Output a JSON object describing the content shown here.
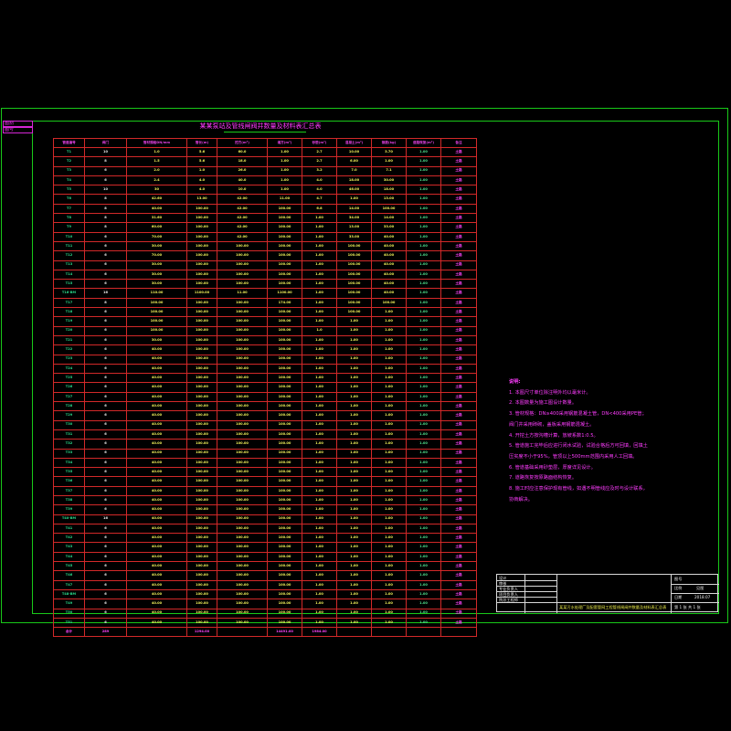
{
  "corner_tab": [
    "图别",
    "图号"
  ],
  "sheet_title": "某某泵站及管线闸阀井数量及材料表汇总表",
  "table": {
    "headers": [
      "管道编号",
      "阀门",
      "管材规格DN/mm",
      "管长(m)",
      "挖方(m³)",
      "填方(m³)",
      "砂垫(m³)",
      "混凝土(m³)",
      "钢筋(kg)",
      "道路恢复(m²)",
      "备注"
    ],
    "rows": [
      [
        "T1",
        "10",
        "1.0",
        "5.6",
        "60.0",
        "1.00",
        "2.7",
        "10.00",
        "3.70",
        "1.00",
        "土路"
      ],
      [
        "T2",
        "8",
        "1.5",
        "5.6",
        "18.0",
        "1.00",
        "2.7",
        "6.00",
        "1.00",
        "1.00",
        "土路"
      ],
      [
        "T3",
        "6",
        "2.0",
        "1.0",
        "26.0",
        "1.00",
        "3.2",
        "7.0",
        "7.1",
        "1.00",
        "土路"
      ],
      [
        "T4",
        "6",
        "2.4",
        "4.0",
        "40.0",
        "1.00",
        "4.0",
        "18.00",
        "30.00",
        "1.00",
        "土路"
      ],
      [
        "T5",
        "10",
        "30",
        "4.0",
        "10.0",
        "1.00",
        "4.0",
        "46.00",
        "18.00",
        "1.00",
        "土路"
      ],
      [
        "T6",
        "8",
        "42.60",
        "13.00",
        "42.00",
        "11.00",
        "4.7",
        "1.00",
        "13.00",
        "1.00",
        "土路"
      ],
      [
        "T7",
        "8",
        "40.00",
        "100.00",
        "42.00",
        "100.00",
        "6.8",
        "14.00",
        "100.00",
        "1.00",
        "土路"
      ],
      [
        "T8",
        "8",
        "31.60",
        "100.00",
        "42.00",
        "100.00",
        "1.00",
        "34.00",
        "14.00",
        "1.00",
        "土路"
      ],
      [
        "T9",
        "8",
        "60.00",
        "100.00",
        "42.00",
        "100.00",
        "1.00",
        "13.00",
        "33.00",
        "1.00",
        "土路"
      ],
      [
        "T10",
        "6",
        "70.00",
        "100.00",
        "42.00",
        "100.00",
        "1.00",
        "33.00",
        "40.00",
        "1.00",
        "土路"
      ],
      [
        "T11",
        "6",
        "30.00",
        "100.00",
        "100.00",
        "100.00",
        "1.00",
        "100.00",
        "40.00",
        "1.00",
        "土路"
      ],
      [
        "T12",
        "6",
        "70.00",
        "100.00",
        "100.00",
        "100.00",
        "1.00",
        "100.00",
        "40.00",
        "1.00",
        "土路"
      ],
      [
        "T13",
        "6",
        "30.00",
        "100.00",
        "100.00",
        "100.00",
        "1.00",
        "100.00",
        "40.00",
        "1.00",
        "土路"
      ],
      [
        "T14",
        "6",
        "30.00",
        "100.00",
        "100.00",
        "100.00",
        "1.00",
        "100.00",
        "40.00",
        "1.00",
        "土路"
      ],
      [
        "T15",
        "6",
        "30.00",
        "100.00",
        "100.00",
        "100.00",
        "1.00",
        "100.00",
        "40.00",
        "1.00",
        "土路"
      ],
      [
        "T16-BM",
        "16",
        "110.00",
        "1100.00",
        "11.00",
        "1100.00",
        "1.00",
        "100.00",
        "40.00",
        "1.00",
        "土路"
      ],
      [
        "T17",
        "8",
        "100.00",
        "100.00",
        "100.00",
        "174.00",
        "1.00",
        "100.00",
        "100.00",
        "1.00",
        "土路"
      ],
      [
        "T18",
        "6",
        "100.00",
        "100.00",
        "100.00",
        "100.00",
        "1.00",
        "100.00",
        "1.00",
        "1.00",
        "土路"
      ],
      [
        "T19",
        "6",
        "100.00",
        "100.00",
        "100.00",
        "100.00",
        "1.00",
        "1.00",
        "1.00",
        "1.00",
        "土路"
      ],
      [
        "T20",
        "6",
        "100.00",
        "100.00",
        "100.00",
        "100.00",
        "1.0",
        "1.00",
        "1.00",
        "1.00",
        "土路"
      ],
      [
        "T21",
        "6",
        "30.00",
        "100.00",
        "100.00",
        "100.00",
        "1.00",
        "1.00",
        "1.00",
        "1.00",
        "土路"
      ],
      [
        "T22",
        "6",
        "40.00",
        "100.00",
        "100.00",
        "100.00",
        "1.00",
        "1.00",
        "1.00",
        "1.00",
        "土路"
      ],
      [
        "T23",
        "6",
        "40.00",
        "100.00",
        "100.00",
        "100.00",
        "1.00",
        "1.00",
        "1.00",
        "1.00",
        "土路"
      ],
      [
        "T24",
        "6",
        "40.00",
        "100.00",
        "100.00",
        "100.00",
        "1.00",
        "1.00",
        "1.00",
        "1.00",
        "土路"
      ],
      [
        "T25",
        "6",
        "40.00",
        "100.00",
        "100.00",
        "100.00",
        "1.00",
        "1.00",
        "1.00",
        "1.00",
        "土路"
      ],
      [
        "T26",
        "6",
        "40.00",
        "100.00",
        "100.00",
        "100.00",
        "1.00",
        "1.00",
        "1.00",
        "1.00",
        "土路"
      ],
      [
        "T27",
        "6",
        "40.00",
        "100.00",
        "100.00",
        "100.00",
        "1.00",
        "1.00",
        "1.00",
        "1.00",
        "土路"
      ],
      [
        "T28",
        "6",
        "40.00",
        "100.00",
        "100.00",
        "100.00",
        "1.00",
        "1.00",
        "1.00",
        "1.00",
        "土路"
      ],
      [
        "T29",
        "6",
        "40.00",
        "100.00",
        "100.00",
        "100.00",
        "1.00",
        "1.00",
        "1.00",
        "1.00",
        "土路"
      ],
      [
        "T30",
        "6",
        "40.00",
        "100.00",
        "100.00",
        "100.00",
        "1.00",
        "1.00",
        "1.00",
        "1.00",
        "土路"
      ],
      [
        "T31",
        "6",
        "40.00",
        "100.00",
        "100.00",
        "100.00",
        "1.00",
        "1.00",
        "1.00",
        "1.00",
        "土路"
      ],
      [
        "T32",
        "6",
        "40.00",
        "100.00",
        "100.00",
        "100.00",
        "1.00",
        "1.00",
        "1.00",
        "1.00",
        "土路"
      ],
      [
        "T33",
        "6",
        "40.00",
        "100.00",
        "100.00",
        "100.00",
        "1.00",
        "1.00",
        "1.00",
        "1.00",
        "土路"
      ],
      [
        "T34",
        "6",
        "40.00",
        "100.00",
        "100.00",
        "100.00",
        "1.00",
        "1.00",
        "1.00",
        "1.00",
        "土路"
      ],
      [
        "T35",
        "6",
        "40.00",
        "100.00",
        "100.00",
        "100.00",
        "1.00",
        "1.00",
        "1.00",
        "1.00",
        "土路"
      ],
      [
        "T36",
        "6",
        "40.00",
        "100.00",
        "100.00",
        "100.00",
        "1.00",
        "1.00",
        "1.00",
        "1.00",
        "土路"
      ],
      [
        "T37",
        "6",
        "40.00",
        "100.00",
        "100.00",
        "100.00",
        "1.00",
        "1.00",
        "1.00",
        "1.00",
        "土路"
      ],
      [
        "T38",
        "6",
        "40.00",
        "100.00",
        "100.00",
        "100.00",
        "1.00",
        "1.00",
        "1.00",
        "1.00",
        "土路"
      ],
      [
        "T39",
        "6",
        "40.00",
        "100.00",
        "100.00",
        "100.00",
        "1.00",
        "1.00",
        "1.00",
        "1.00",
        "土路"
      ],
      [
        "T40-BM",
        "16",
        "40.00",
        "100.00",
        "100.00",
        "100.00",
        "1.00",
        "1.00",
        "1.00",
        "1.00",
        "土路"
      ],
      [
        "T41",
        "6",
        "40.00",
        "100.00",
        "100.00",
        "100.00",
        "1.00",
        "1.00",
        "1.00",
        "1.00",
        "土路"
      ],
      [
        "T42",
        "6",
        "40.00",
        "100.00",
        "100.00",
        "100.00",
        "1.00",
        "1.00",
        "1.00",
        "1.00",
        "土路"
      ],
      [
        "T43",
        "6",
        "40.00",
        "100.00",
        "100.00",
        "100.00",
        "1.00",
        "1.00",
        "1.00",
        "1.00",
        "土路"
      ],
      [
        "T44",
        "6",
        "40.00",
        "100.00",
        "100.00",
        "100.00",
        "1.00",
        "1.00",
        "1.00",
        "1.00",
        "土路"
      ],
      [
        "T45",
        "6",
        "40.00",
        "100.00",
        "100.00",
        "100.00",
        "1.00",
        "1.00",
        "1.00",
        "1.00",
        "土路"
      ],
      [
        "T46",
        "6",
        "40.00",
        "100.00",
        "100.00",
        "100.00",
        "1.00",
        "1.00",
        "1.00",
        "1.00",
        "土路"
      ],
      [
        "T47",
        "6",
        "40.00",
        "100.00",
        "100.00",
        "100.00",
        "1.00",
        "1.00",
        "1.00",
        "1.00",
        "土路"
      ],
      [
        "T48-BM",
        "6",
        "40.00",
        "100.00",
        "100.00",
        "100.00",
        "1.00",
        "1.00",
        "1.00",
        "1.00",
        "土路"
      ],
      [
        "T49",
        "6",
        "40.00",
        "100.00",
        "100.00",
        "100.00",
        "1.00",
        "1.00",
        "1.00",
        "1.00",
        "土路"
      ],
      [
        "T50",
        "6",
        "40.00",
        "100.00",
        "100.00",
        "100.00",
        "1.00",
        "1.00",
        "1.00",
        "1.00",
        "土路"
      ],
      [
        "T51",
        "6",
        "40.00",
        "100.00",
        "100.00",
        "100.00",
        "1.00",
        "1.00",
        "1.00",
        "1.00",
        "土路"
      ]
    ],
    "total": [
      "合计",
      "289",
      "",
      "1294.00",
      "",
      "14491.00",
      "1984.00",
      "",
      "",
      "",
      ""
    ]
  },
  "notes": {
    "title": "说明:",
    "lines": [
      "1. 本图尺寸单位除注明外均以毫米计。",
      "2. 本图数量为施工图设计数量。",
      "3. 管材规格：DN≥400采用钢筋混凝土管，DN<400采用PE管；",
      "   阀门井采用砖砌，盖板采用钢筋混凝土。",
      "4. 开挖土方按沟槽计算，放坡系数1:0.5。",
      "5. 管道施工完毕后应进行闭水试验，试验合格后方可回填，回填土",
      "   压实度不小于95%，管顶以上500mm范围内采用人工回填。",
      "6. 管道基础采用砂垫层，厚度详见设计。",
      "7. 道路恢复按原路面结构恢复。",
      "8. 施工时应注意保护现有管线，如遇不明管线应及时与设计联系，",
      "   协商解决。"
    ]
  },
  "title_block": {
    "left_labels": [
      "设计",
      "审核",
      "专业负责人",
      "项目负责人",
      "院总工程师"
    ],
    "right_labels": [
      "图号",
      "比例",
      "日期"
    ],
    "right_values": [
      "",
      "见图",
      "2018.07"
    ],
    "drawing_name": "某某污水处理厂及配套管网工程管线闸阀井数量及材料表汇总表",
    "sheet": "第 1 张  共 1 张"
  }
}
